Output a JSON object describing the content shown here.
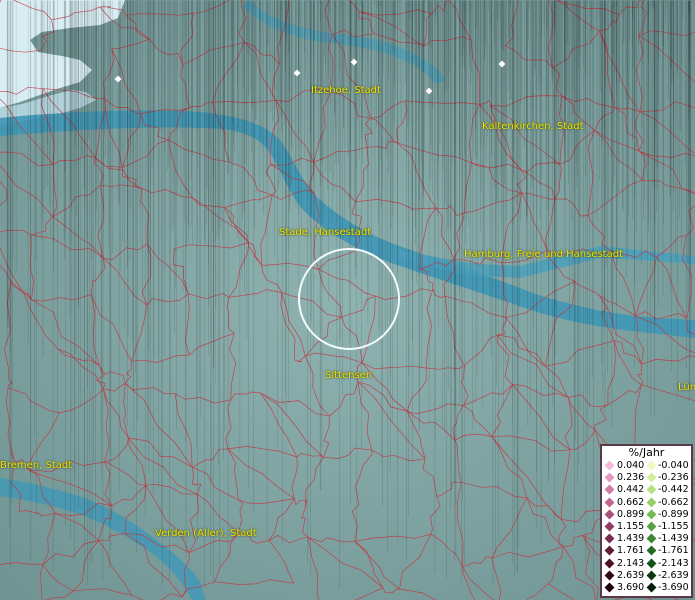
{
  "map": {
    "cities": [
      "Itzehoe, Stadt",
      "Kaltenkirchen, Stadt",
      "Stade, Hansestadt",
      "Hamburg, Freie und Hansestadt",
      "Sittensen",
      "Bremen, Stadt",
      "Verden (Aller), Stadt",
      "Lün"
    ],
    "colors": {
      "water": "#3f97b6",
      "land": "#7fa3a3",
      "borders": "#c8323c",
      "sea": "#d8eef4"
    }
  },
  "legend": {
    "title": "%/Jahr",
    "positive": [
      {
        "value": "0.040",
        "color": "#f7b6dc"
      },
      {
        "value": "0.236",
        "color": "#e596c2"
      },
      {
        "value": "0.442",
        "color": "#d27aa6"
      },
      {
        "value": "0.662",
        "color": "#bf6590"
      },
      {
        "value": "0.899",
        "color": "#a85078"
      },
      {
        "value": "1.155",
        "color": "#923e64"
      },
      {
        "value": "1.439",
        "color": "#7a2c4e"
      },
      {
        "value": "1.761",
        "color": "#611c3a"
      },
      {
        "value": "2.143",
        "color": "#4a0f28"
      },
      {
        "value": "2.639",
        "color": "#32061a"
      },
      {
        "value": "3.690",
        "color": "#1a000b"
      }
    ],
    "negative": [
      {
        "value": "-0.040",
        "color": "#eef8c2"
      },
      {
        "value": "-0.236",
        "color": "#d2efa0"
      },
      {
        "value": "-0.442",
        "color": "#b4e184"
      },
      {
        "value": "-0.662",
        "color": "#94cf6a"
      },
      {
        "value": "-0.899",
        "color": "#74bb54"
      },
      {
        "value": "-1.155",
        "color": "#56a242"
      },
      {
        "value": "-1.439",
        "color": "#3c8732"
      },
      {
        "value": "-1.761",
        "color": "#266c24"
      },
      {
        "value": "-2.143",
        "color": "#165318"
      },
      {
        "value": "-2.639",
        "color": "#0a3a0e"
      },
      {
        "value": "-3.690",
        "color": "#031f06"
      }
    ]
  }
}
